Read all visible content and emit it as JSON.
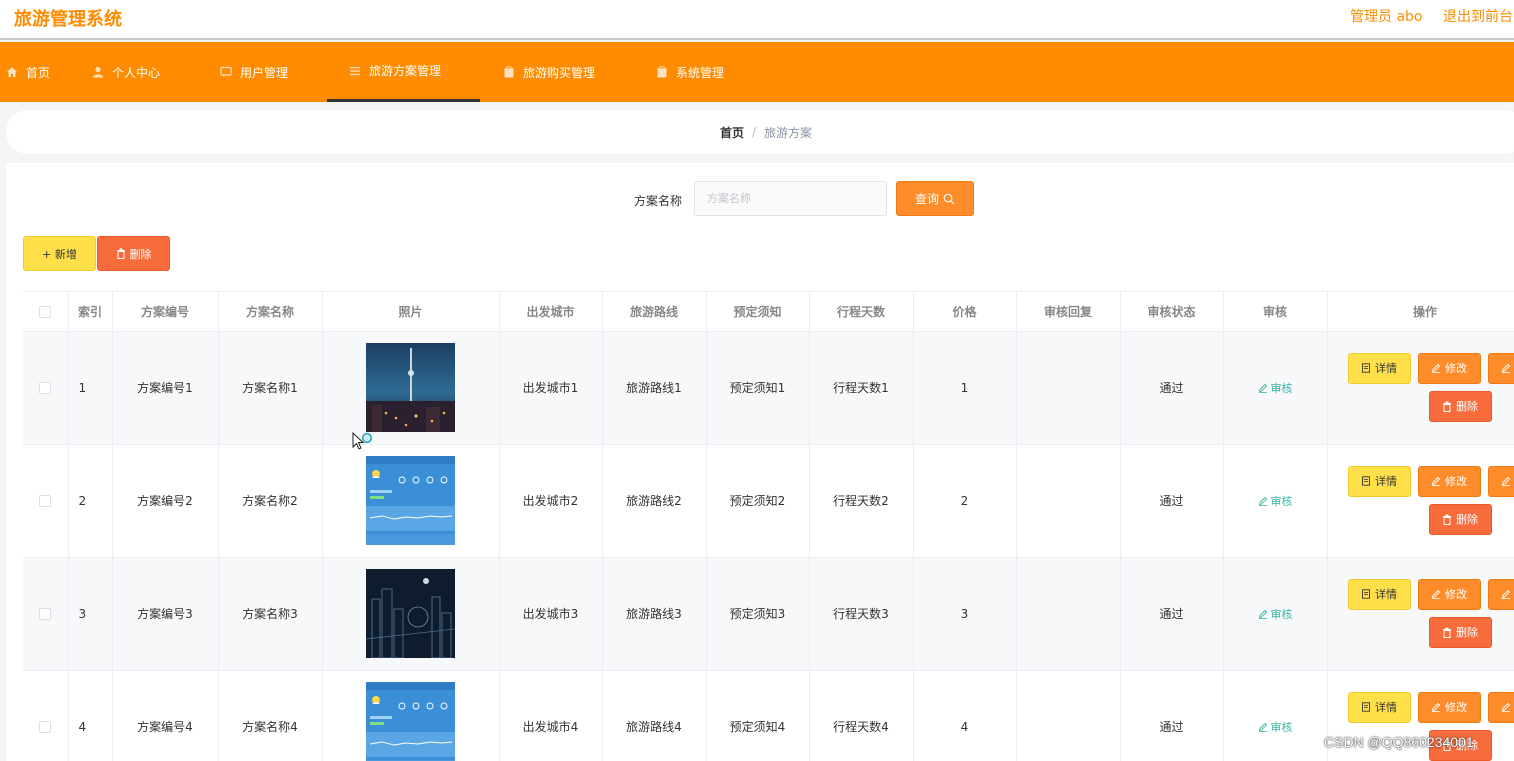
{
  "header": {
    "title": "旅游管理系统",
    "user": "管理员 abo",
    "logout": "退出到前台"
  },
  "nav": {
    "items": [
      {
        "label": "首页",
        "icon": "home-icon"
      },
      {
        "label": "个人中心",
        "icon": "user-icon"
      },
      {
        "label": "用户管理",
        "icon": "chat-icon"
      },
      {
        "label": "旅游方案管理",
        "icon": "list-icon",
        "active": true
      },
      {
        "label": "旅游购买管理",
        "icon": "clipboard-icon"
      },
      {
        "label": "系统管理",
        "icon": "clipboard-icon"
      }
    ]
  },
  "breadcrumb": {
    "home": "首页",
    "separator": "/",
    "current": "旅游方案"
  },
  "search": {
    "label": "方案名称",
    "placeholder": "方案名称",
    "button": "查询"
  },
  "toolbar": {
    "add": "+ 新增",
    "delete": "删除"
  },
  "table": {
    "headers": [
      "",
      "索引",
      "方案编号",
      "方案名称",
      "照片",
      "出发城市",
      "旅游路线",
      "预定须知",
      "行程天数",
      "价格",
      "审核回复",
      "审核状态",
      "审核",
      "操作"
    ],
    "rows": [
      {
        "index": "1",
        "code": "方案编号1",
        "name": "方案名称1",
        "photo": "city-night-photo",
        "city": "出发城市1",
        "route": "旅游路线1",
        "notice": "预定须知1",
        "days": "行程天数1",
        "price": "1",
        "reply": "",
        "status": "通过",
        "audit": "审核"
      },
      {
        "index": "2",
        "code": "方案编号2",
        "name": "方案名称2",
        "photo": "weather-screenshot-photo",
        "city": "出发城市2",
        "route": "旅游路线2",
        "notice": "预定须知2",
        "days": "行程天数2",
        "price": "2",
        "reply": "",
        "status": "通过",
        "audit": "审核"
      },
      {
        "index": "3",
        "code": "方案编号3",
        "name": "方案名称3",
        "photo": "city-skyline-photo",
        "city": "出发城市3",
        "route": "旅游路线3",
        "notice": "预定须知3",
        "days": "行程天数3",
        "price": "3",
        "reply": "",
        "status": "通过",
        "audit": "审核"
      },
      {
        "index": "4",
        "code": "方案编号4",
        "name": "方案名称4",
        "photo": "weather-screenshot-photo",
        "city": "出发城市4",
        "route": "旅游路线4",
        "notice": "预定须知4",
        "days": "行程天数4",
        "price": "4",
        "reply": "",
        "status": "通过",
        "audit": "审核"
      }
    ],
    "ops": {
      "detail": "详情",
      "edit": "修改",
      "delete": "删除"
    }
  },
  "watermark": "CSDN @QQ860234001",
  "colors": {
    "brand": "#ff8c00",
    "add": "#ffe04a",
    "danger": "#f86c3c",
    "audit": "#39b5a4"
  }
}
